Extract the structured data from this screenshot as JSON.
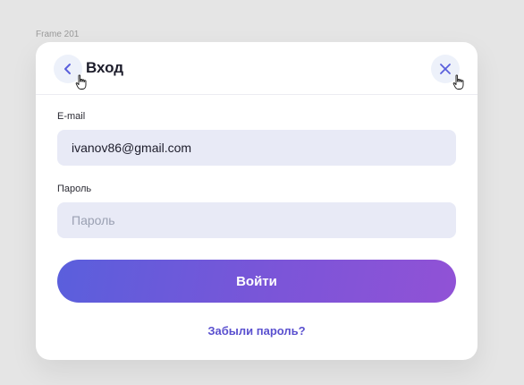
{
  "canvas": {
    "frame_label": "Frame 201"
  },
  "modal": {
    "title": "Вход",
    "back_icon": "chevron-left-icon",
    "close_icon": "close-icon",
    "email": {
      "label": "E-mail",
      "value": "ivanov86@gmail.com"
    },
    "password": {
      "label": "Пароль",
      "placeholder": "Пароль",
      "value": ""
    },
    "submit_label": "Войти",
    "forgot_label": "Забыли пароль?"
  },
  "colors": {
    "accent": "#5a50cf",
    "gradient_start": "#5a5fdc",
    "gradient_end": "#9152d6",
    "field_bg": "#e8eaf6"
  }
}
